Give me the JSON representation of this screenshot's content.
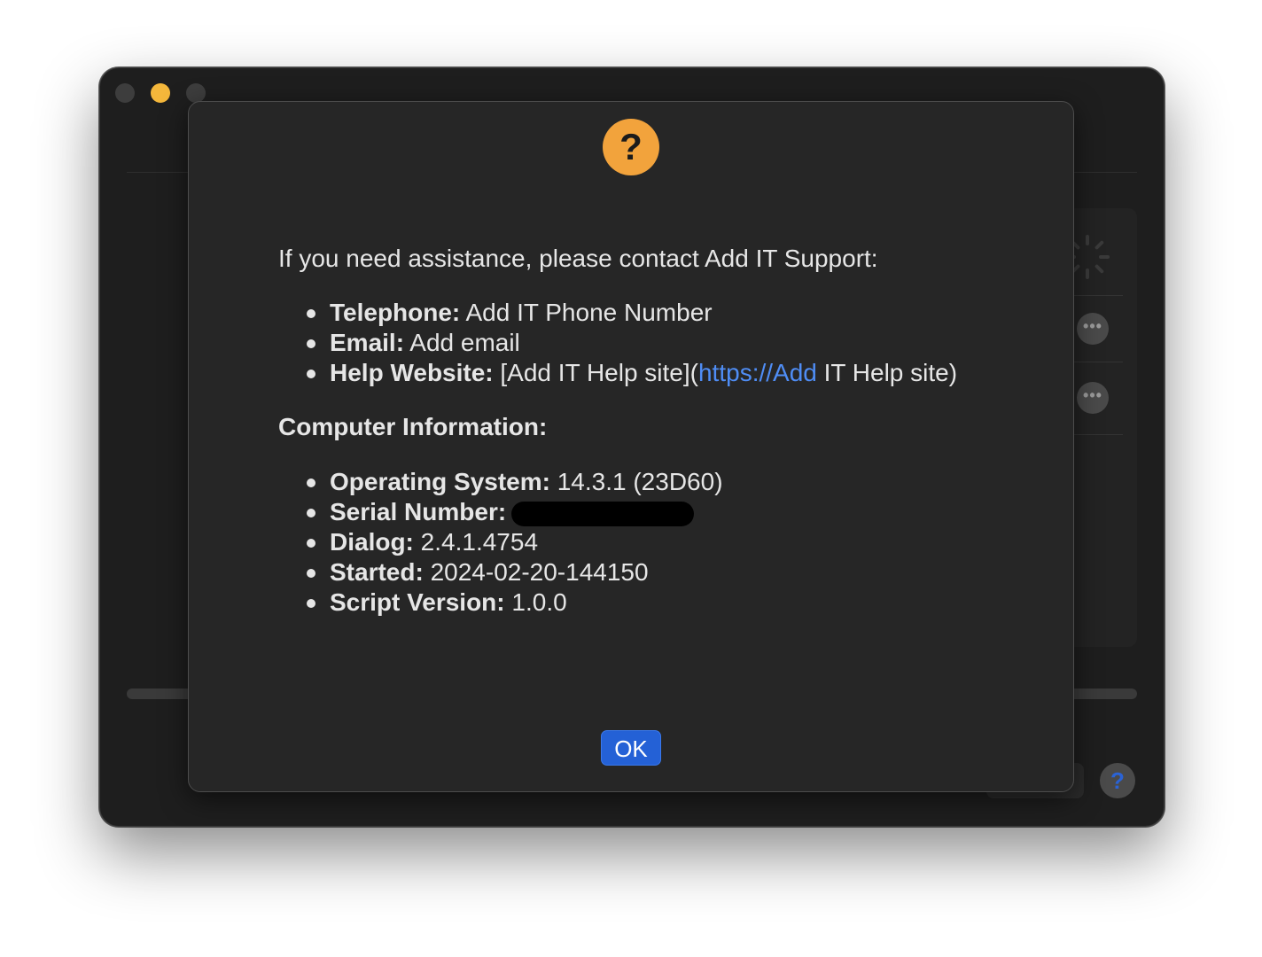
{
  "dialog": {
    "intro": "If you need assistance, please contact Add IT Support:",
    "contacts": [
      {
        "label": "Telephone:",
        "value": " Add IT Phone Number"
      },
      {
        "label": "Email:",
        "value": " Add email"
      },
      {
        "label": "Help Website:",
        "value_prefix": " [Add IT Help site](",
        "link": "https://Add",
        "value_suffix": " IT Help site)"
      }
    ],
    "computer_info_title": "Computer Information:",
    "computer_info": [
      {
        "label": "Operating System:",
        "value": "  14.3.1 (23D60)"
      },
      {
        "label": "Serial Number:",
        "value": ""
      },
      {
        "label": "Dialog:",
        "value": " 2.4.1.4754"
      },
      {
        "label": "Started:",
        "value": " 2024-02-20-144150"
      },
      {
        "label": "Script Version:",
        "value": " 1.0.0"
      }
    ],
    "ok_label": "OK",
    "icon": "question-mark-icon"
  },
  "window": {
    "help_button_label": "?",
    "more_label": "•••"
  },
  "colors": {
    "icon_orange": "#f2a33c",
    "link_blue": "#4f8df5",
    "ok_blue": "#2461d6",
    "minimize_yellow": "#f4b73b"
  }
}
